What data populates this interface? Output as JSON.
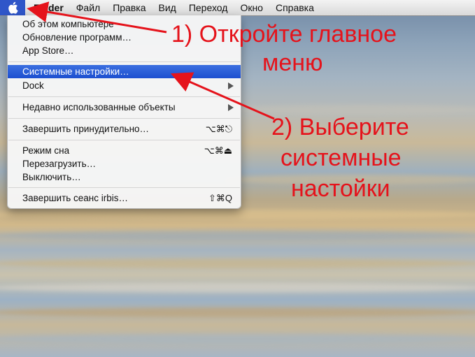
{
  "menubar": {
    "apple_icon": "apple-icon",
    "items": [
      "Finder",
      "Файл",
      "Правка",
      "Вид",
      "Переход",
      "Окно",
      "Справка"
    ]
  },
  "apple_menu": {
    "items": [
      {
        "label": "Об этом компьютере"
      },
      {
        "label": "Обновление программ…"
      },
      {
        "label": "App Store…"
      },
      {
        "label": "Системные настройки…",
        "selected": true
      },
      {
        "label": "Dock",
        "submenu": true
      },
      {
        "label": "Недавно использованные объекты",
        "submenu": true
      },
      {
        "label": "Завершить принудительно…",
        "shortcut": "⌥⌘⎋"
      },
      {
        "label": "Режим сна",
        "shortcut": "⌥⌘⏏"
      },
      {
        "label": "Перезагрузить…"
      },
      {
        "label": "Выключить…"
      },
      {
        "label": "Завершить сеанс irbis…",
        "shortcut": "⇧⌘Q"
      }
    ]
  },
  "annotations": {
    "step1_line1": "1) Откройте главное",
    "step1_line2": "меню",
    "step2_line1": "2) Выберите",
    "step2_line2": "системные",
    "step2_line3": "настойки",
    "color": "#e5131b"
  }
}
